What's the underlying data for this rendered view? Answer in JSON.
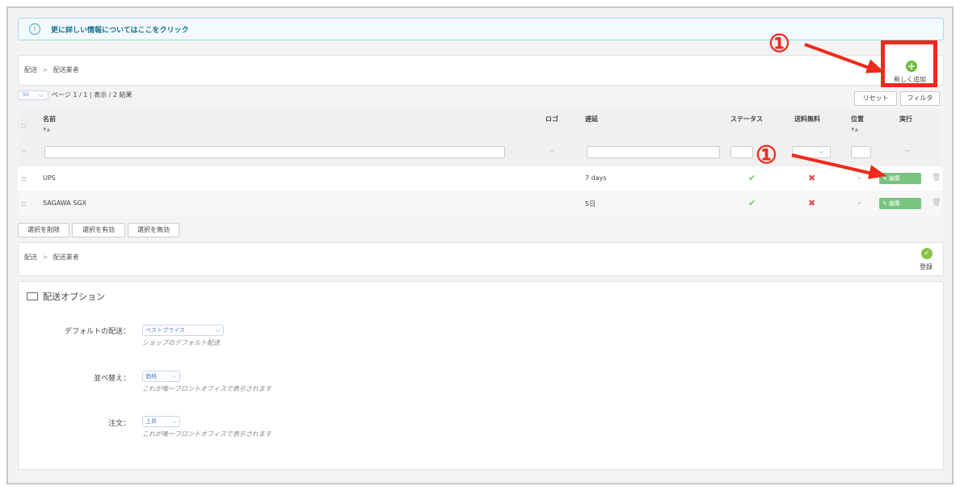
{
  "info_banner": {
    "icon": "info-icon",
    "text": "更に詳しい情報についてはここをクリック"
  },
  "breadcrumb_top": {
    "parent": "配送",
    "separator": ">",
    "current": "配送業者"
  },
  "add_new_label": "新しく追加",
  "pagination": {
    "per_page": "50",
    "text": "ページ 1 / 1 | 表示 / 2 結果"
  },
  "toolbar": {
    "reset_label": "リセット",
    "filter_label": "フィルタ"
  },
  "table": {
    "headers": {
      "name": "名前",
      "logo": "ロゴ",
      "delay": "遅延",
      "status": "ステータス",
      "free_shipping": "送料無料",
      "position": "位置",
      "actions": "実行"
    },
    "sort_arrows": "▼▲",
    "filter_placeholder": "--",
    "rows": [
      {
        "name": "UPS",
        "delay": "7 days",
        "status": "✔",
        "free": "✖",
        "position": "-",
        "edit": "編集"
      },
      {
        "name": "SAGAWA SGX",
        "delay": "5日",
        "status": "✔",
        "free": "✖",
        "position": "-",
        "edit": "編集"
      }
    ]
  },
  "bulk_actions": {
    "delete": "選択を削除",
    "enable": "選択を有効",
    "disable": "選択を無効"
  },
  "breadcrumb_bottom": {
    "parent": "配送",
    "separator": ">",
    "current": "配送業者"
  },
  "save_label": "登録",
  "options": {
    "title": "配送オプション",
    "default_carrier": {
      "label": "デフォルトの配送：",
      "value": "ベストプライス",
      "hint": "ショップのデフォルト配送"
    },
    "sort_by": {
      "label": "並べ替え：",
      "value": "価格",
      "hint": "これが唯一フロントオフィスで表示されます"
    },
    "order": {
      "label": "注文：",
      "value": "上昇",
      "hint": "これが唯一フロントオフィスで表示されます"
    }
  },
  "annotations": {
    "marker": "①",
    "color": "#ee2a1c"
  }
}
